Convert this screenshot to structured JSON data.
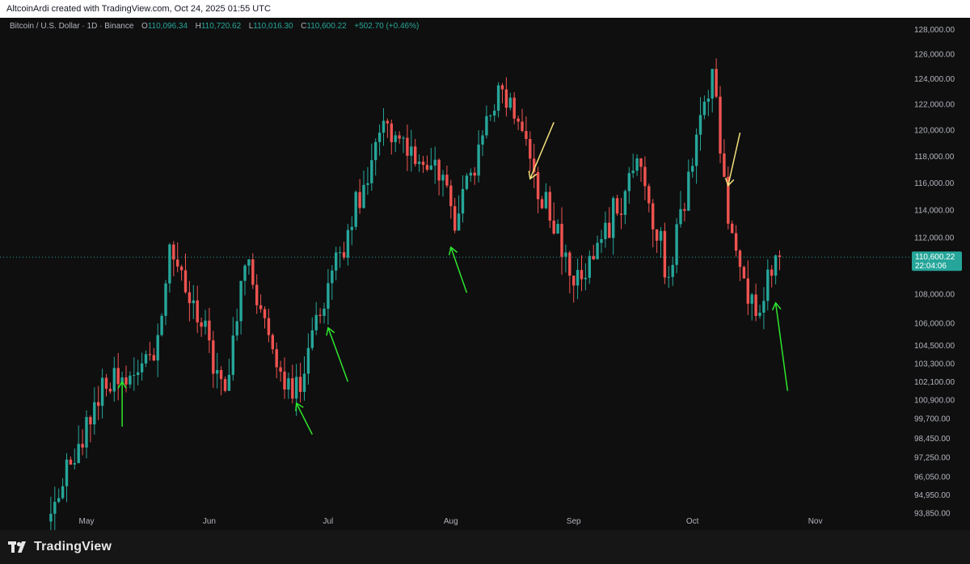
{
  "header": {
    "attribution": "AltcoinArdi created with TradingView.com, Oct 24, 2025 01:55 UTC"
  },
  "legend": {
    "symbol": "Bitcoin / U.S. Dollar · 1D · Binance",
    "open_label": "O",
    "open": "110,096.34",
    "high_label": "H",
    "high": "110,720.62",
    "low_label": "L",
    "low": "110,016.30",
    "close_label": "C",
    "close": "110,600.22",
    "change": "+502.70 (+0.46%)"
  },
  "price_tag": {
    "price": "110,600.22",
    "countdown": "22:04:06"
  },
  "brand": {
    "name": "TradingView",
    "logo_icon": "tradingview-logo-icon"
  },
  "colors": {
    "up": "#26a69a",
    "down": "#ef5350",
    "green_arrow": "#2ee62e",
    "yellow_arrow": "#f3e17a",
    "axis_text": "#b2b5be",
    "tag_bg": "#26a69a"
  },
  "chart_data": {
    "type": "candlestick",
    "title": "Bitcoin / U.S. Dollar · 1D · Binance",
    "xlabel": "",
    "ylabel": "",
    "ylim": [
      93500,
      128300
    ],
    "log_scale": true,
    "grid": false,
    "x_ticks": [
      {
        "label": "May",
        "date": "2025-05-01"
      },
      {
        "label": "Jun",
        "date": "2025-06-01"
      },
      {
        "label": "Jul",
        "date": "2025-07-01"
      },
      {
        "label": "Aug",
        "date": "2025-08-01"
      },
      {
        "label": "Sep",
        "date": "2025-09-01"
      },
      {
        "label": "Oct",
        "date": "2025-10-01"
      },
      {
        "label": "Nov",
        "date": "2025-11-01"
      }
    ],
    "y_ticks": [
      "128,000.00",
      "126,000.00",
      "124,000.00",
      "122,000.00",
      "120,000.00",
      "118,000.00",
      "116,000.00",
      "114,000.00",
      "112,000.00",
      "108,000.00",
      "106,000.00",
      "104,500.00",
      "103,300.00",
      "102,100.00",
      "100,900.00",
      "99,700.00",
      "98,450.00",
      "97,250.00",
      "96,050.00",
      "94,950.00",
      "93,850.00"
    ],
    "last_price": 110600.22,
    "key_closes": [
      {
        "date": "2025-04-22",
        "close": 93800
      },
      {
        "date": "2025-05-08",
        "close": 103000
      },
      {
        "date": "2025-05-12",
        "close": 102500
      },
      {
        "date": "2025-05-18",
        "close": 103500
      },
      {
        "date": "2025-05-22",
        "close": 111500
      },
      {
        "date": "2025-06-05",
        "close": 101500
      },
      {
        "date": "2025-06-10",
        "close": 110000
      },
      {
        "date": "2025-06-22",
        "close": 101000
      },
      {
        "date": "2025-06-30",
        "close": 107000
      },
      {
        "date": "2025-07-14",
        "close": 119800
      },
      {
        "date": "2025-07-31",
        "close": 115800
      },
      {
        "date": "2025-08-02",
        "close": 112500
      },
      {
        "date": "2025-08-13",
        "close": 123500
      },
      {
        "date": "2025-08-22",
        "close": 116800
      },
      {
        "date": "2025-09-01",
        "close": 108600
      },
      {
        "date": "2025-09-18",
        "close": 117200
      },
      {
        "date": "2025-09-25",
        "close": 109200
      },
      {
        "date": "2025-10-06",
        "close": 124800
      },
      {
        "date": "2025-10-10",
        "close": 113000
      },
      {
        "date": "2025-10-17",
        "close": 106500
      },
      {
        "date": "2025-10-23",
        "close": 110600.22
      }
    ],
    "annotations": [
      {
        "type": "arrow",
        "color": "green",
        "tip": {
          "date": "2025-05-10",
          "price": 102100
        },
        "tail": {
          "date": "2025-05-10",
          "price": 99200
        }
      },
      {
        "type": "arrow",
        "color": "green",
        "tip": {
          "date": "2025-06-23",
          "price": 100700
        },
        "tail": {
          "date": "2025-06-27",
          "price": 98700
        }
      },
      {
        "type": "arrow",
        "color": "green",
        "tip": {
          "date": "2025-07-01",
          "price": 105700
        },
        "tail": {
          "date": "2025-07-06",
          "price": 102100
        }
      },
      {
        "type": "arrow",
        "color": "green",
        "tip": {
          "date": "2025-08-01",
          "price": 111300
        },
        "tail": {
          "date": "2025-08-05",
          "price": 108100
        }
      },
      {
        "type": "arrow",
        "color": "yellow",
        "tip": {
          "date": "2025-08-21",
          "price": 116300
        },
        "tail": {
          "date": "2025-08-27",
          "price": 120600
        }
      },
      {
        "type": "arrow",
        "color": "yellow",
        "tip": {
          "date": "2025-10-10",
          "price": 115800
        },
        "tail": {
          "date": "2025-10-13",
          "price": 119800
        }
      },
      {
        "type": "arrow",
        "color": "green",
        "tip": {
          "date": "2025-10-22",
          "price": 107400
        },
        "tail": {
          "date": "2025-10-25",
          "price": 101500
        }
      }
    ]
  }
}
